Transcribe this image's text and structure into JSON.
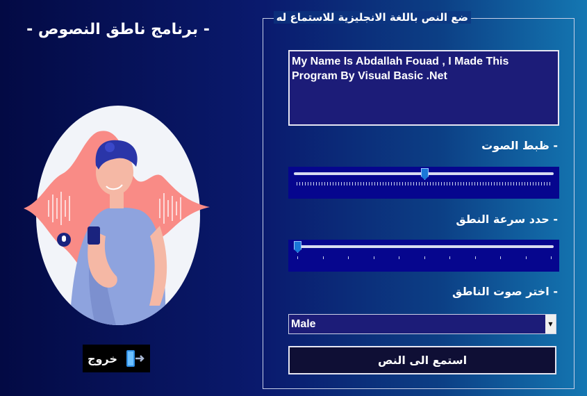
{
  "app_title": "- برنامج ناطق النصوص -",
  "exit_button": {
    "label": "خروج",
    "icon": "exit-door-icon"
  },
  "group": {
    "title": "ضع النص باللغة الانجليزية للاستماع له",
    "text_input_value": "My Name Is Abdallah Fouad , I Made This Program By Visual Basic .Net",
    "volume": {
      "label": "- ظبط الصوت",
      "value_fraction": 0.5
    },
    "rate": {
      "label": "- حدد سرعة النطق",
      "value_fraction": 0.0
    },
    "voice": {
      "label": "- اختر صوت الناطق",
      "selected": "Male"
    },
    "listen_button": "استمع الى النص"
  },
  "colors": {
    "panel_bg": "#1c1c78",
    "track_bg": "#06068e",
    "thumb": "#1a78d8",
    "illustration_wave": "#f98b86",
    "illustration_bg": "#f2f4f9"
  }
}
